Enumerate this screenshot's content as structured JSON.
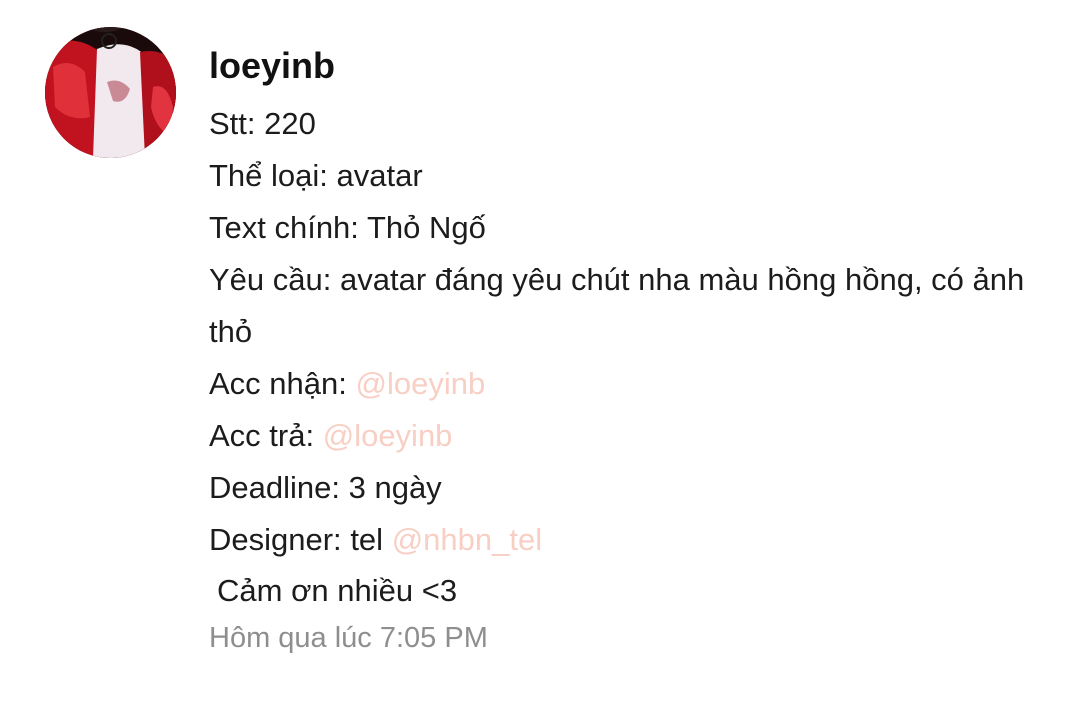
{
  "post": {
    "username": "loeyinb",
    "stt": {
      "label": "Stt:",
      "value": "220"
    },
    "the_loai": {
      "label": "Thể loại:",
      "value": "avatar"
    },
    "text_chinh": {
      "label": "Text chính:",
      "value": "Thỏ Ngố"
    },
    "yeu_cau": {
      "label": "Yêu cầu:",
      "value": "avatar đáng yêu chút nha màu hồng hồng, có ảnh thỏ"
    },
    "acc_nhan": {
      "label": "Acc nhận:",
      "mention": "@loeyinb"
    },
    "acc_tra": {
      "label": "Acc trả:",
      "mention": "@loeyinb"
    },
    "deadline": {
      "label": "Deadline:",
      "value": "3 ngày"
    },
    "designer": {
      "label": "Designer:",
      "value": "tel",
      "mention": "@nhbn_tel"
    },
    "thanks": "Cảm ơn nhiều <3",
    "timestamp": "Hôm qua lúc 7:05 PM"
  },
  "colors": {
    "mention": "#f8cfc4",
    "timestamp": "#8e8e8e",
    "text": "#1c1c1c",
    "avatar_jacket": "#b81620"
  },
  "icons": {
    "avatar": "profile-photo-red-jacket"
  }
}
